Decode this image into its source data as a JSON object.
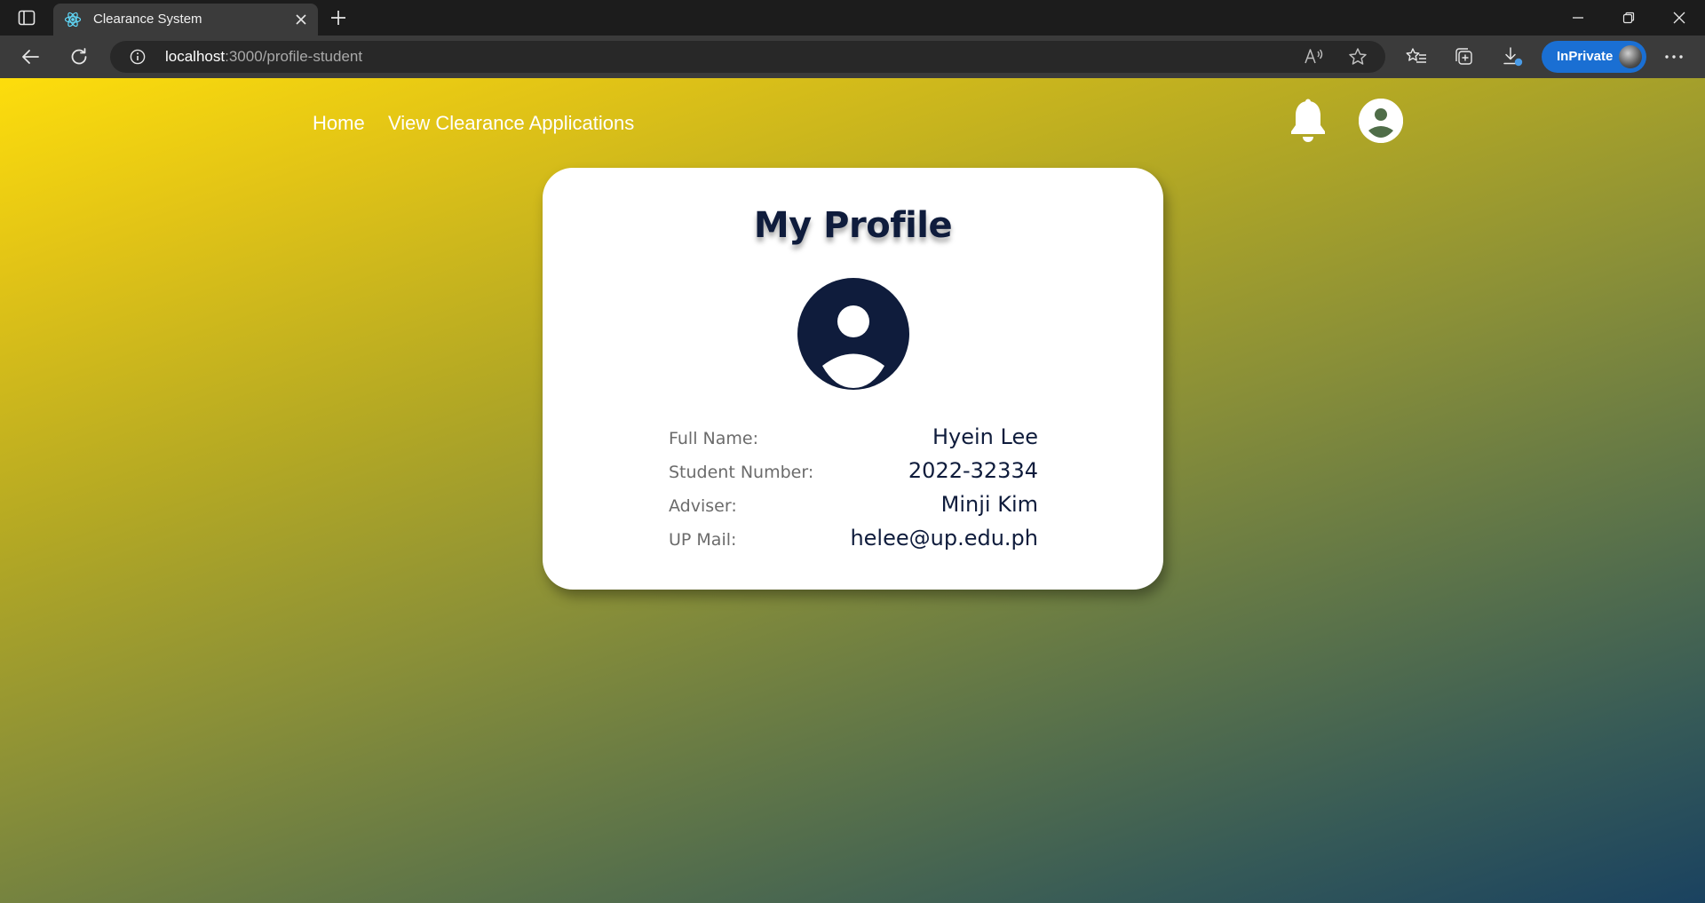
{
  "browser": {
    "tab_title": "Clearance System",
    "url_host": "localhost",
    "url_path": ":3000/profile-student",
    "inprivate_label": "InPrivate",
    "icons": [
      "sidebar-icon",
      "react-favicon",
      "close-icon",
      "plus-icon",
      "minimize-icon",
      "restore-icon",
      "window-close-icon",
      "back-icon",
      "refresh-icon",
      "info-icon",
      "read-aloud-icon",
      "star-icon",
      "favorites-icon",
      "collections-icon",
      "download-icon",
      "more-icon"
    ]
  },
  "nav": {
    "home": "Home",
    "view_applications": "View Clearance Applications",
    "icons": [
      "bell-icon",
      "account-icon"
    ]
  },
  "profile": {
    "title": "My Profile",
    "fields": [
      {
        "label": "Full Name:",
        "value": "Hyein Lee"
      },
      {
        "label": "Student Number:",
        "value": "2022-32334"
      },
      {
        "label": "Adviser:",
        "value": "Minji Kim"
      },
      {
        "label": "UP Mail:",
        "value": "helee@up.edu.ph"
      }
    ]
  },
  "colors": {
    "gradient_start": "#fddd0c",
    "gradient_end": "#1a4260",
    "navy": "#0f1c3c",
    "inprivate": "#1a6fd3"
  }
}
